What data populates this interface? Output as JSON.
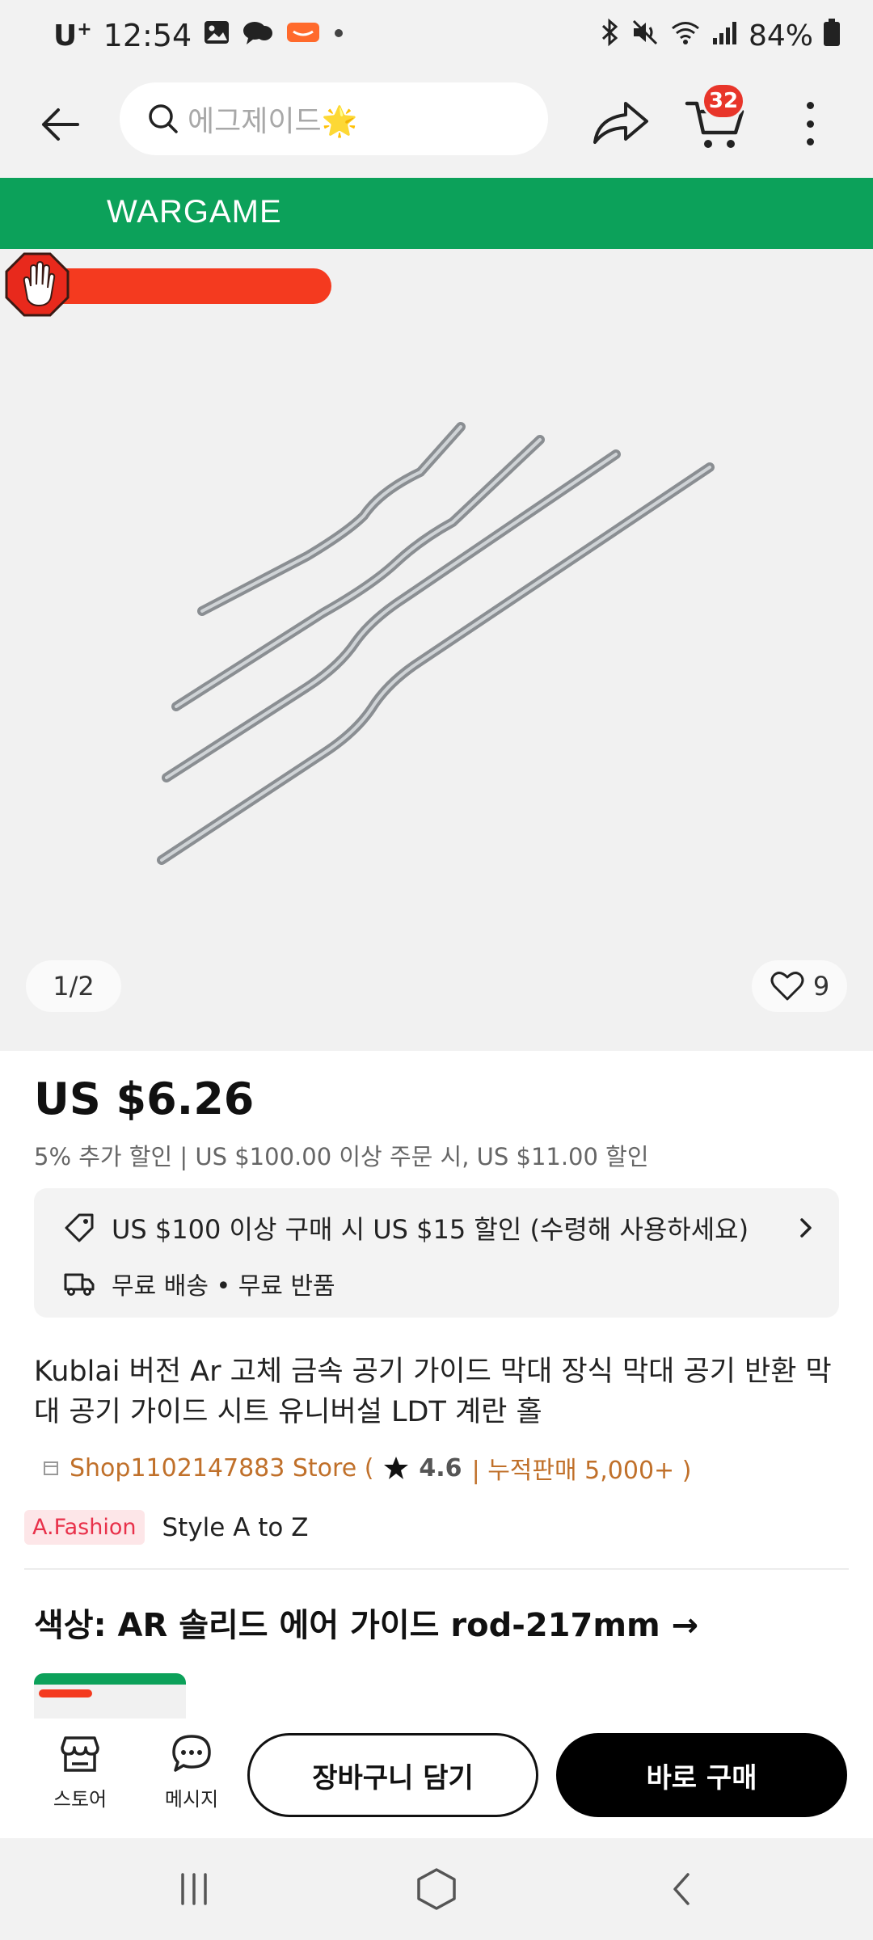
{
  "status_bar": {
    "carrier": "U",
    "carrier_sup": "+",
    "time": "12:54",
    "battery": "84%"
  },
  "search": {
    "placeholder": "에그제이드🌟"
  },
  "cart": {
    "badge_count": "32"
  },
  "banner": {
    "brand": "WARGAME"
  },
  "gallery": {
    "counter": "1/2",
    "like_count": "9"
  },
  "price": {
    "current": "US $6.26",
    "discount_line": "5% 추가 할인 | US $100.00 이상 주문 시, US $11.00 할인"
  },
  "coupon": {
    "text": "US $100 이상 구매 시 US $15 할인 (수령해 사용하세요)",
    "shipping": "무료 배송 • 무료 반품"
  },
  "product": {
    "title": "Kublai 버전 Ar 고체 금속 공기 가이드 막대 장식 막대 공기 반환 막대 공기 가이드 시트 유니버설 LDT 계란 홀"
  },
  "store": {
    "name": "Shop1102147883 Store (",
    "rating": "4.6",
    "sales": "| 누적판매 5,000+ )"
  },
  "tags": {
    "badge": "A.Fashion",
    "text": "Style A to Z"
  },
  "variant": {
    "title": "색상: AR 솔리드 에어 가이드 rod-217mm →"
  },
  "actions": {
    "store_label": "스토어",
    "message_label": "메시지",
    "add_cart_label": "장바구니 담기",
    "buy_now_label": "바로 구매"
  },
  "colors": {
    "brand_green": "#0ca15a",
    "promo_red": "#f43a1f",
    "badge_red": "#e8352a",
    "store_orange": "#c0702a",
    "buy_black": "#000000"
  }
}
